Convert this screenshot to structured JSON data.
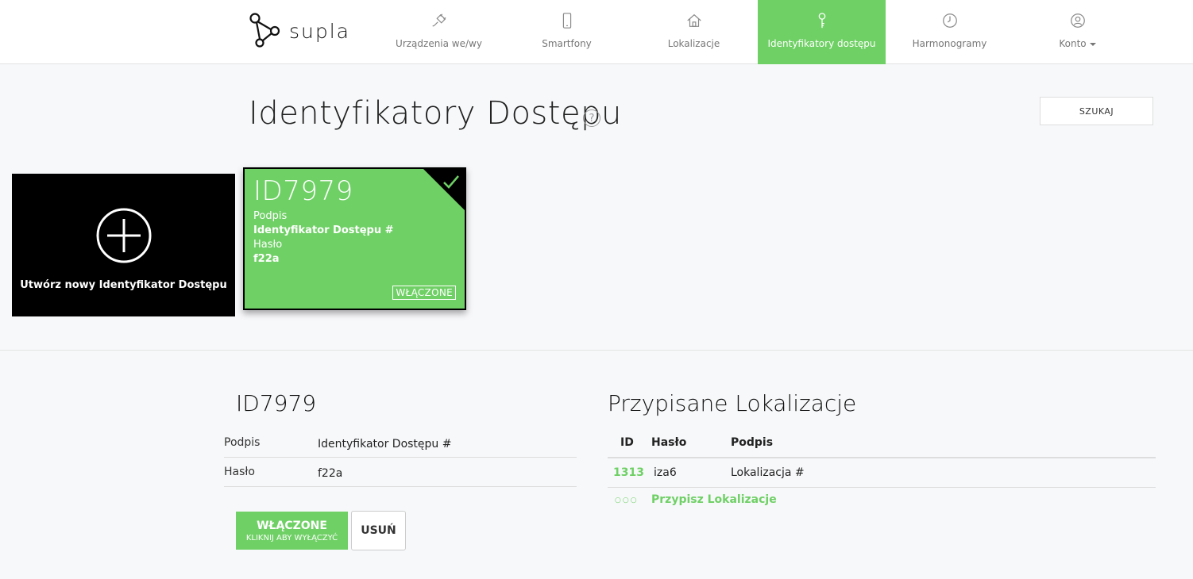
{
  "brand": {
    "name": "supla"
  },
  "nav": {
    "items": [
      {
        "label": "Urządzenia we/wy",
        "icon": "plug-icon"
      },
      {
        "label": "Smartfony",
        "icon": "smartphone-icon"
      },
      {
        "label": "Lokalizacje",
        "icon": "home-icon"
      },
      {
        "label": "Identyfikatory dostępu",
        "icon": "key-icon",
        "active": true
      },
      {
        "label": "Harmonogramy",
        "icon": "clock-icon"
      },
      {
        "label": "Konto",
        "icon": "user-icon",
        "dropdown": true
      }
    ]
  },
  "header": {
    "title": "Identyfikatory Dostępu",
    "help": "?",
    "search_label": "SZUKAJ"
  },
  "new_card": {
    "label": "Utwórz nowy Identyfikator Dostępu"
  },
  "cards": [
    {
      "id": "ID7979",
      "caption_label": "Podpis",
      "caption_value": "Identyfikator Dostępu #",
      "password_label": "Hasło",
      "password_value": "f22a",
      "status": "WŁĄCZONE"
    }
  ],
  "details": {
    "title": "ID7979",
    "rows": [
      {
        "label": "Podpis",
        "value": "Identyfikator Dostępu #"
      },
      {
        "label": "Hasło",
        "value": "f22a"
      }
    ],
    "toggle_main": "WŁĄCZONE",
    "toggle_sub": "KLIKNIJ ABY WYŁĄCZYĆ",
    "delete_label": "USUŃ"
  },
  "assigned": {
    "title": "Przypisane Lokalizacje",
    "columns": [
      "ID",
      "Hasło",
      "Podpis"
    ],
    "rows": [
      {
        "id": "1313",
        "password": "iza6",
        "caption": "Lokalizacja #"
      }
    ],
    "assign_dots": "○○○",
    "assign_label": "Przypisz Lokalizacje"
  },
  "colors": {
    "accent": "#6fd065",
    "black": "#000000",
    "background": "#f7f8fa"
  }
}
